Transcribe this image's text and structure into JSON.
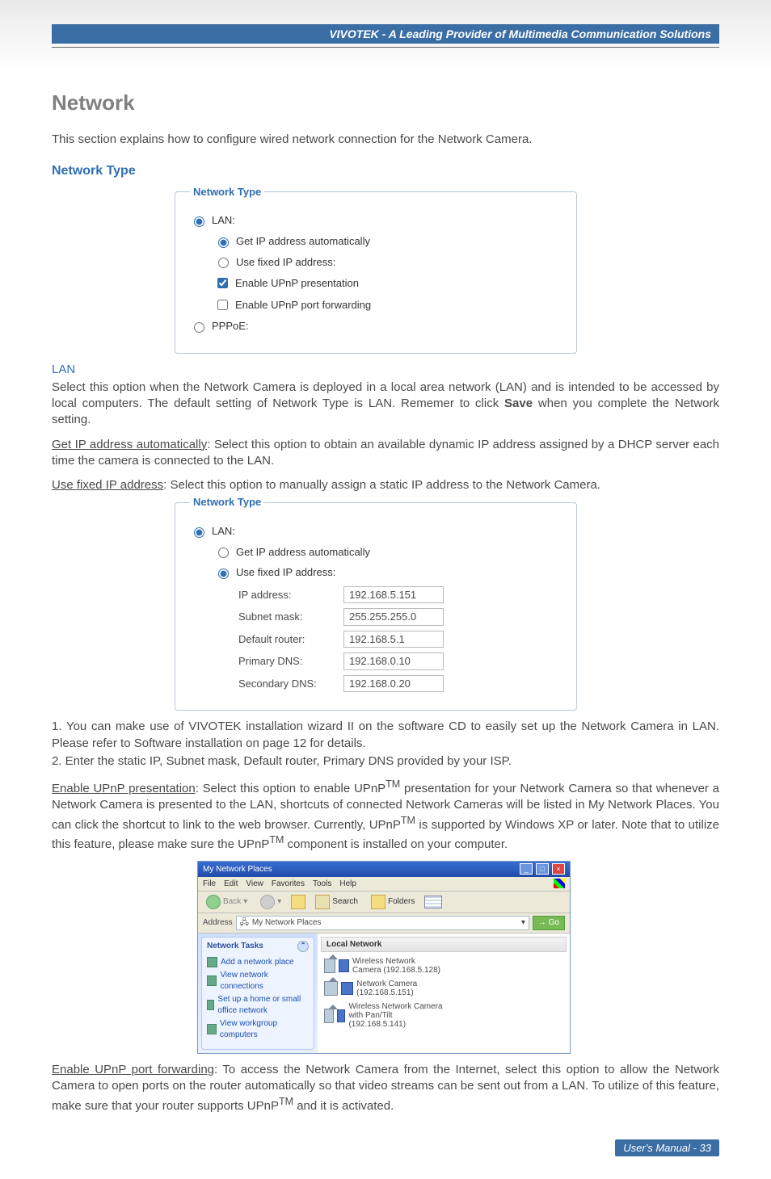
{
  "brand_header": "VIVOTEK - A Leading Provider of Multimedia Communication Solutions",
  "h1": "Network",
  "intro": "This section explains how to configure wired network connection for the Network Camera.",
  "h2_network_type": "Network Type",
  "panel1": {
    "legend": "Network Type",
    "lan_label": "LAN:",
    "get_ip_auto": "Get IP address automatically",
    "use_fixed_ip": "Use fixed IP address:",
    "enable_upnp_pres": "Enable UPnP presentation",
    "enable_upnp_port": "Enable UPnP port forwarding",
    "pppoe_label": "PPPoE:"
  },
  "lan_heading": "LAN",
  "lan_para": "Select this option when the Network Camera is deployed in a local area network (LAN) and is intended to be accessed by local computers. The default setting of Network Type is LAN. Rememer to click ",
  "lan_save": "Save",
  "lan_para_end": " when you complete the Network setting.",
  "get_ip_para_label": "Get IP address automatically",
  "get_ip_para": ": Select this option to obtain an available dynamic IP address assigned by a DHCP server each time the camera is connected to the LAN.",
  "use_fixed_label": "Use fixed IP address",
  "use_fixed_para": ": Select this option to manually assign a static IP address to the Network Camera.",
  "panel2": {
    "legend": "Network Type",
    "lan_label": "LAN:",
    "get_ip_auto": "Get IP address automatically",
    "use_fixed_ip": "Use fixed IP address:",
    "fields": {
      "ip_label": "IP address:",
      "ip_value": "192.168.5.151",
      "subnet_label": "Subnet mask:",
      "subnet_value": "255.255.255.0",
      "router_label": "Default router:",
      "router_value": "192.168.5.1",
      "pdns_label": "Primary DNS:",
      "pdns_value": "192.168.0.10",
      "sdns_label": "Secondary DNS:",
      "sdns_value": "192.168.0.20"
    }
  },
  "list1": "1. You can make use of VIVOTEK installation wizard II on the software CD to easily set up the Network Camera in LAN. Please refer to Software installation on page 12 for details.",
  "list2": "2. Enter the static IP, Subnet mask, Default router, Primary DNS provided by your ISP.",
  "upnp_pres_label": "Enable UPnP presentation",
  "upnp_pres_para_1": ": Select this option to enable UPnP",
  "tm": "TM",
  "upnp_pres_para_2": " presentation for your Network Camera so that whenever a Network Camera is presented to the LAN, shortcuts of connected Network Cameras will be listed in My Network Places. You can click the shortcut to link to the web browser. Currently, UPnP",
  "upnp_pres_para_3": " is supported by Windows XP or later. Note that to utilize this feature, please make sure the UPnP",
  "upnp_pres_para_4": " component is installed on your computer.",
  "np": {
    "title": "My Network Places",
    "menu": [
      "File",
      "Edit",
      "View",
      "Favorites",
      "Tools",
      "Help"
    ],
    "back": "Back",
    "search": "Search",
    "folders": "Folders",
    "addr_label": "Address",
    "addr_value": "My Network Places",
    "go": "Go",
    "side_title": "Network Tasks",
    "side_links": [
      "Add a network place",
      "View network connections",
      "Set up a home or small office network",
      "View workgroup computers"
    ],
    "main_header": "Local Network",
    "items": [
      {
        "name": "Wireless Network Camera (192.168.5.128)"
      },
      {
        "name": "Network Camera (192.168.5.151)"
      },
      {
        "name": "Wireless Network Camera with Pan/Tilt (192.168.5.141)"
      }
    ]
  },
  "upnp_port_label": "Enable UPnP port forwarding",
  "upnp_port_para_1": ": To access the Network Camera from the Internet, select this option to allow the Network Camera to open ports on the router automatically so that video streams can be sent out from a LAN. To utilize of this feature, make sure that your router supports UPnP",
  "upnp_port_para_2": " and it is activated.",
  "footer": "User's Manual - 33"
}
